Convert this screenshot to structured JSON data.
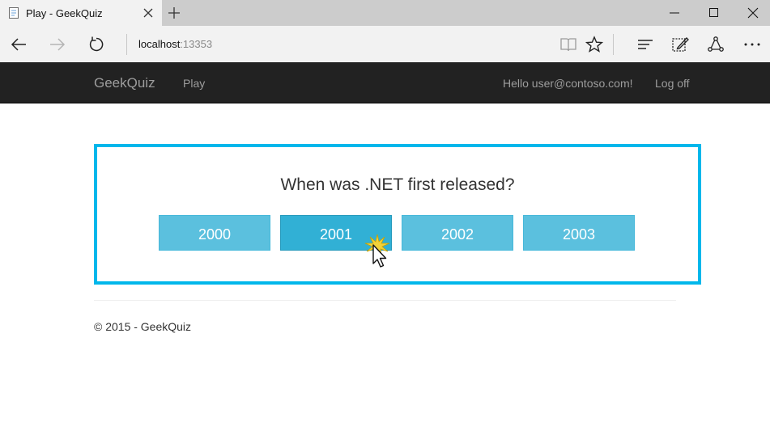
{
  "browser": {
    "tab": {
      "title": "Play - GeekQuiz"
    },
    "address": {
      "host": "localhost",
      "port": ":13353"
    }
  },
  "site": {
    "brand": "GeekQuiz",
    "nav": {
      "play": "Play",
      "greeting": "Hello user@contoso.com!",
      "logoff": "Log off"
    }
  },
  "quiz": {
    "question": "When was .NET first released?",
    "options": [
      "2000",
      "2001",
      "2002",
      "2003"
    ],
    "highlighted_option": "2001"
  },
  "footer": {
    "text": "© 2015 - GeekQuiz"
  },
  "colors": {
    "accent": "#00b7eb",
    "button": "#5bc0de",
    "button_active": "#31b0d5",
    "navbar": "#222222"
  }
}
